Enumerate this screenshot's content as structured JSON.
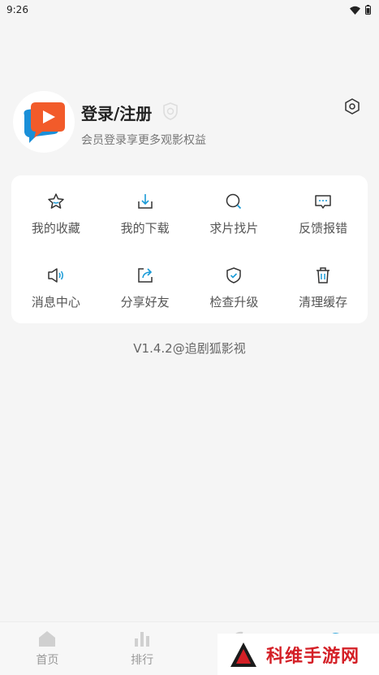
{
  "status_bar": {
    "time": "9:26"
  },
  "profile": {
    "title": "登录/注册",
    "subtitle": "会员登录享更多观影权益"
  },
  "menu": [
    {
      "label": "我的收藏",
      "icon": "star-icon"
    },
    {
      "label": "我的下载",
      "icon": "download-icon"
    },
    {
      "label": "求片找片",
      "icon": "search-icon"
    },
    {
      "label": "反馈报错",
      "icon": "feedback-icon"
    },
    {
      "label": "消息中心",
      "icon": "speaker-icon"
    },
    {
      "label": "分享好友",
      "icon": "share-icon"
    },
    {
      "label": "检查升级",
      "icon": "shield-check-icon"
    },
    {
      "label": "清理缓存",
      "icon": "trash-icon"
    }
  ],
  "version": "V1.4.2@追剧狐影视",
  "tabs": [
    {
      "label": "首页"
    },
    {
      "label": "排行"
    }
  ],
  "watermark": {
    "text": "科维手游网"
  },
  "colors": {
    "accent": "#1a9bd7",
    "watermark": "#d41f26"
  }
}
